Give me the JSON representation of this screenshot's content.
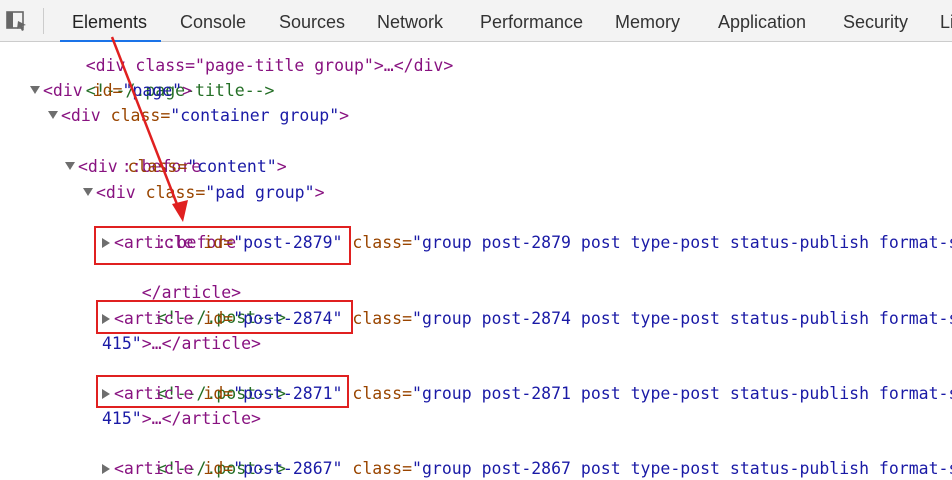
{
  "tabs": [
    {
      "label": "Elements",
      "active": true
    },
    {
      "label": "Console"
    },
    {
      "label": "Sources"
    },
    {
      "label": "Network"
    },
    {
      "label": "Performance"
    },
    {
      "label": "Memory"
    },
    {
      "label": "Application"
    },
    {
      "label": "Security"
    },
    {
      "label": "Li"
    }
  ],
  "tree": {
    "l0": {
      "text": "<div class=\"page-title group\">…</div>"
    },
    "l1": {
      "comment": "<!--/.page-title-->"
    },
    "l2": {
      "open": "<div ",
      "attr": "id=",
      "val": "\"page\"",
      "close": ">"
    },
    "l3": {
      "open": "<div ",
      "attr": "class=",
      "val": "\"container group\"",
      "close": ">"
    },
    "l4": {
      "pseudo": "::before"
    },
    "l5": {
      "open": "<div ",
      "attr": "class=",
      "val": "\"content\"",
      "close": ">"
    },
    "l6": {
      "open": "<div ",
      "attr": "class=",
      "val": "\"pad group\"",
      "close": ">"
    },
    "l7": {
      "pseudo": "::before"
    },
    "l8": {
      "open": "<article ",
      "attr": "id=",
      "val": "\"post-2879\"",
      "attr2": " class=",
      "val2": "\"group post-2879 post type-post status-publish format-s"
    },
    "l9": {
      "close": "</article>"
    },
    "l10": {
      "comment": "<!--/.post-->"
    },
    "l11": {
      "open": "<article ",
      "attr": "id=",
      "val": "\"post-2874\"",
      "attr2": " class=",
      "val2": "\"group post-2874 post type-post status-publish format-s"
    },
    "l12": {
      "val": "415\"",
      "close": ">…</article>"
    },
    "l13": {
      "comment": "<!--/.post-->"
    },
    "l14": {
      "open": "<article ",
      "attr": "id=",
      "val": "\"post-2871\"",
      "attr2": " class=",
      "val2": "\"group post-2871 post type-post status-publish format-s"
    },
    "l15": {
      "val": "415\"",
      "close": ">…</article>"
    },
    "l16": {
      "comment": "<!--/.post-->"
    },
    "l17": {
      "open": "<article ",
      "attr": "id=",
      "val": "\"post-2867\"",
      "attr2": " class=",
      "val2": "\"group post-2867 post type-post status-publish format-s"
    }
  },
  "colors": {
    "tag": "#881280",
    "attr": "#994500",
    "value": "#1a1aa6",
    "comment": "#236e25",
    "highlight": "#e02020",
    "active_tab": "#1a73e8"
  },
  "icons": {
    "inspect": "inspect-element-icon",
    "arrow": "annotation-arrow"
  }
}
